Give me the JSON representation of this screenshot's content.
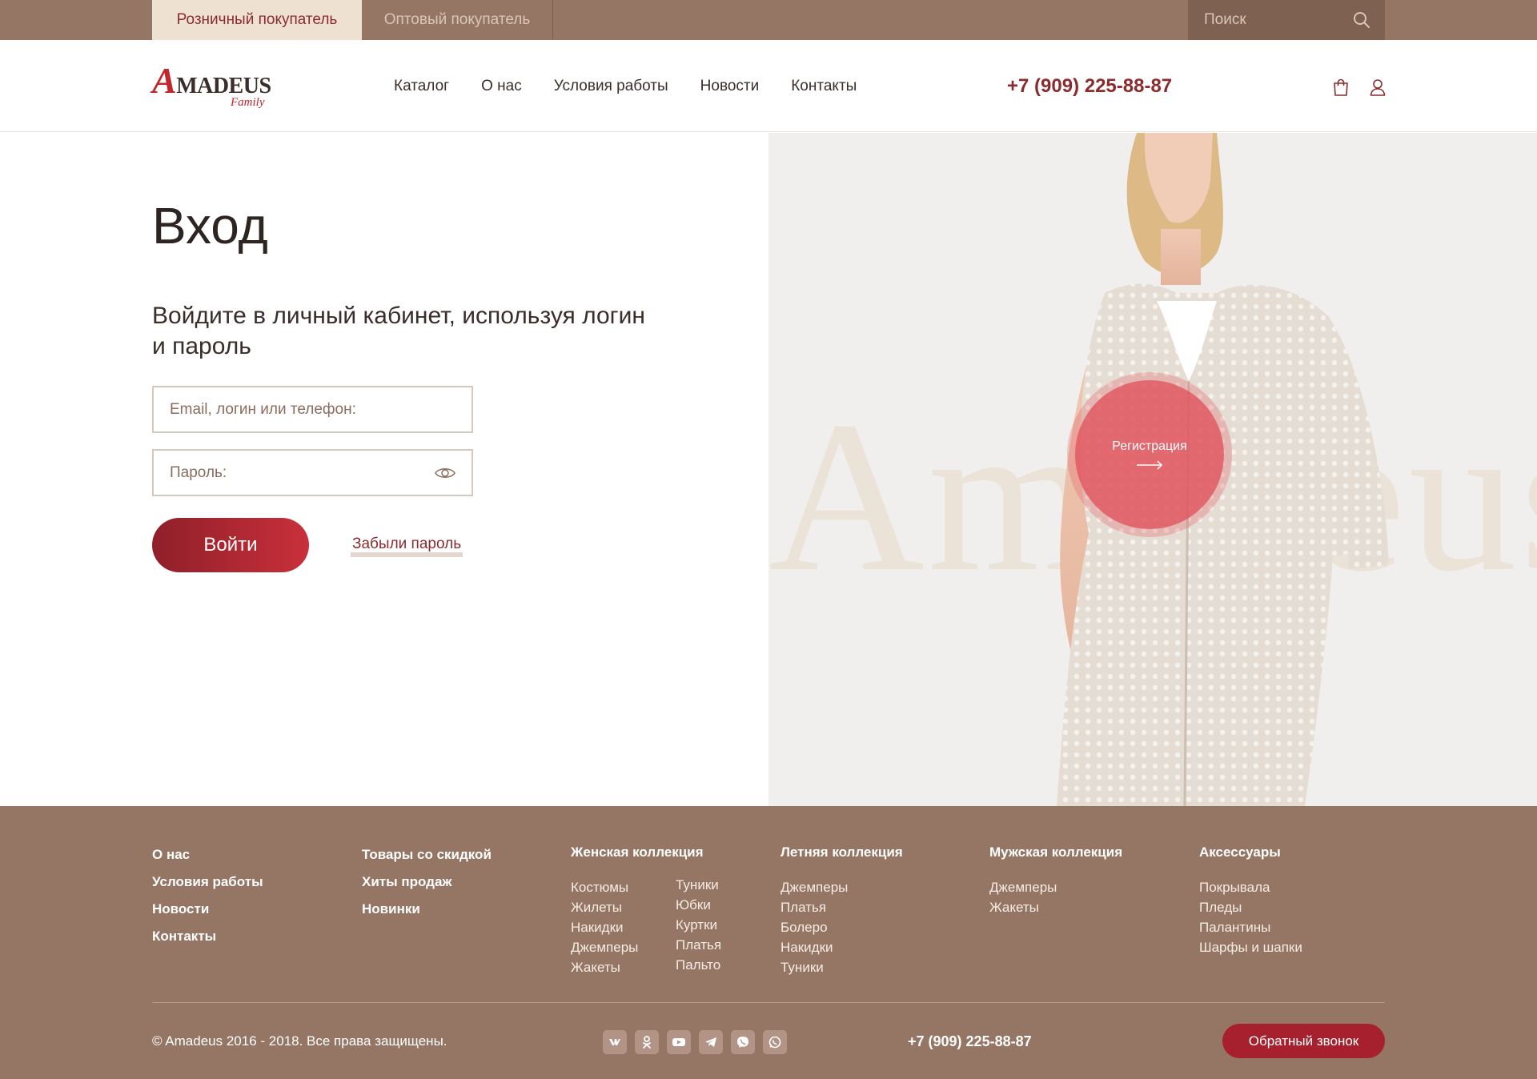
{
  "topbar": {
    "tab_retail": "Розничный покупатель",
    "tab_wholesale": "Оптовый покупатель",
    "search_placeholder": "Поиск"
  },
  "header": {
    "logo_main": "MADEUS",
    "logo_letter": "A",
    "logo_sub": "Family",
    "nav": [
      "Каталог",
      "О нас",
      "Условия работы",
      "Новости",
      "Контакты"
    ],
    "phone": "+7 (909) 225-88-87"
  },
  "login": {
    "title": "Вход",
    "subtitle": "Войдите в личный кабинет, используя логин и пароль",
    "email_placeholder": "Email, логин или телефон:",
    "password_placeholder": "Пароль:",
    "submit_label": "Войти",
    "forgot_label": "Забыли пароль"
  },
  "hero": {
    "watermark": "Amadeus",
    "register_label": "Регистрация"
  },
  "footer": {
    "col1": [
      "О нас",
      "Условия работы",
      "Новости",
      "Контакты"
    ],
    "col2": [
      "Товары со скидкой",
      "Хиты продаж",
      "Новинки"
    ],
    "col3": {
      "title": "Женская коллекция",
      "left": [
        "Костюмы",
        "Жилеты",
        "Накидки",
        "Джемперы",
        "Жакеты"
      ],
      "right": [
        "Туники",
        "Юбки",
        "Куртки",
        "Платья",
        "Пальто"
      ]
    },
    "col4": {
      "title": "Летняя коллекция",
      "items": [
        "Джемперы",
        "Платья",
        "Болеро",
        "Накидки",
        "Туники"
      ]
    },
    "col5": {
      "title": "Мужская коллекция",
      "items": [
        "Джемперы",
        "Жакеты"
      ]
    },
    "col6": {
      "title": "Аксессуары",
      "items": [
        "Покрывала",
        "Пледы",
        "Палантины",
        "Шарфы и шапки"
      ]
    },
    "copyright": "© Amadeus 2016 - 2018. Все права защищены.",
    "socials": [
      "vk-icon",
      "odnoklassniki-icon",
      "youtube-icon",
      "telegram-icon",
      "viber-icon",
      "whatsapp-icon"
    ],
    "phone": "+7 (909) 225-88-87",
    "callback_label": "Обратный звонок"
  },
  "colors": {
    "brand_brown": "#957665",
    "accent_red": "#a6212d",
    "tab_active_bg": "#efe1d2"
  }
}
